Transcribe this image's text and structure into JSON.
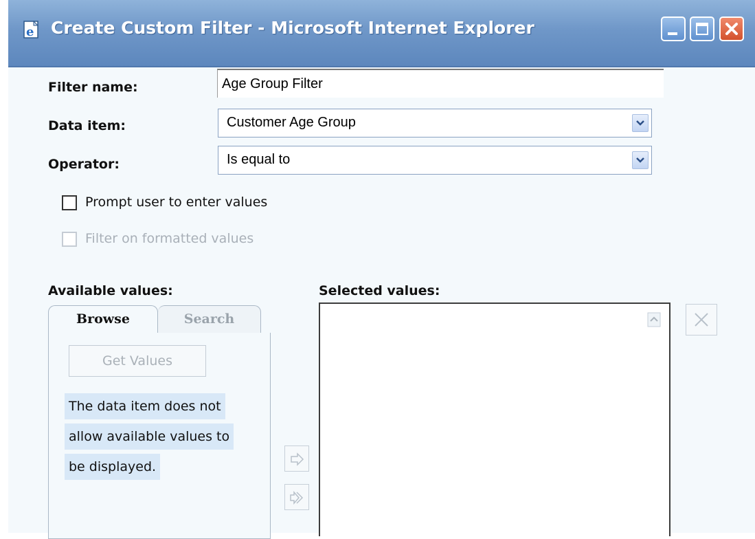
{
  "window": {
    "title": "Create Custom Filter - Microsoft Internet Explorer"
  },
  "form": {
    "filter_name_label": "Filter name:",
    "filter_name_value": "Age Group Filter",
    "data_item_label": "Data item:",
    "data_item_value": "Customer Age Group",
    "operator_label": "Operator:",
    "operator_value": "Is equal to",
    "prompt_checkbox_label": "Prompt user to enter values",
    "prompt_checked": false,
    "formatted_checkbox_label": "Filter on formatted values",
    "formatted_checked": false,
    "formatted_enabled": false
  },
  "available": {
    "label": "Available values:",
    "tabs": [
      "Browse",
      "Search"
    ],
    "active_tab": "Browse",
    "get_values_label": "Get Values",
    "info_lines": [
      "The data item does not",
      "allow available values to",
      "be displayed."
    ]
  },
  "selected": {
    "label": "Selected values:",
    "items": []
  },
  "colors": {
    "titlebar": "#6f97c8",
    "close_button": "#d3512c",
    "panel_bg": "#f4f9fc",
    "info_highlight": "#d8e8f7"
  }
}
